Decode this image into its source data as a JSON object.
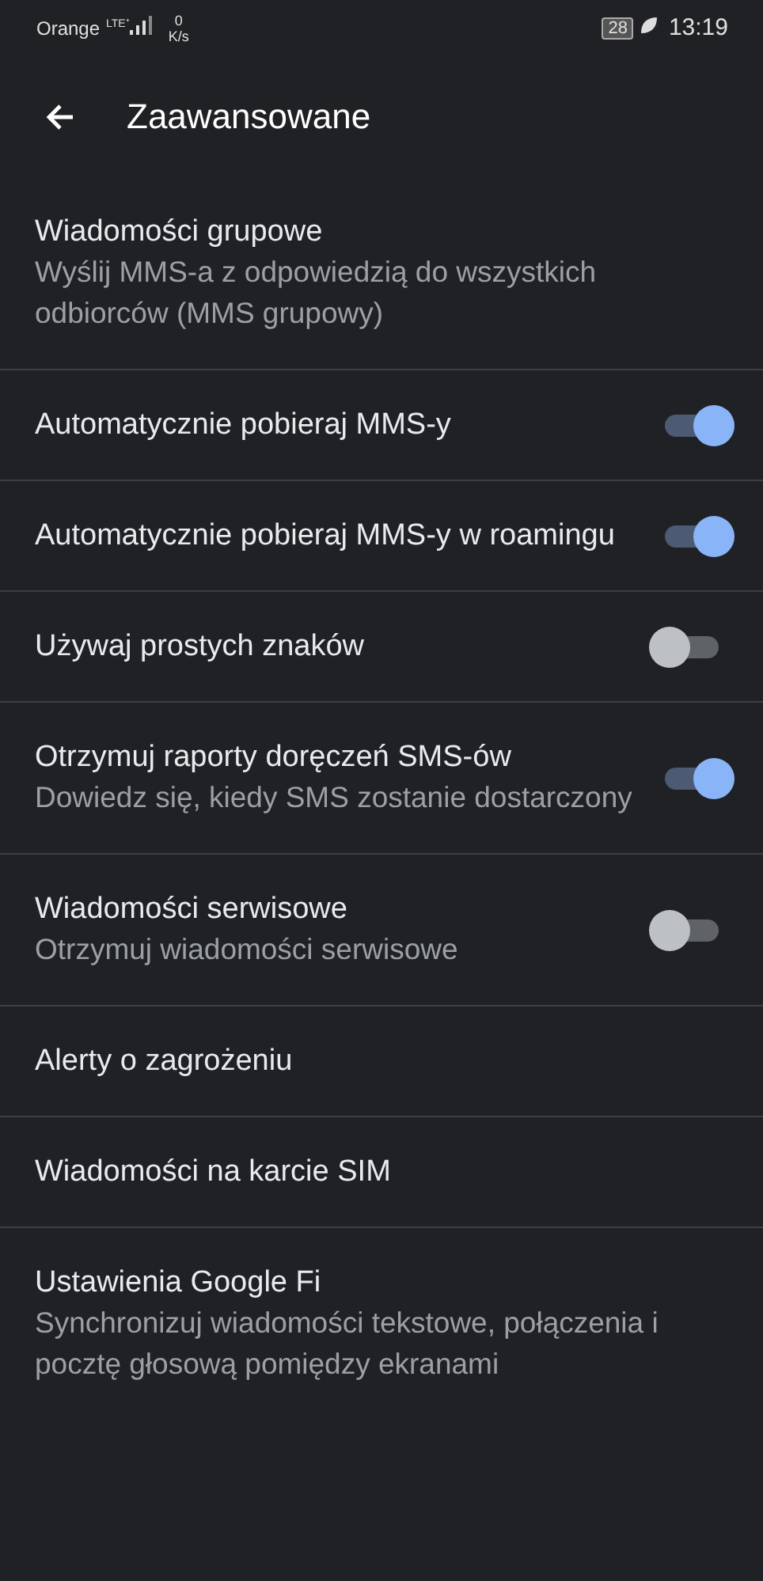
{
  "status_bar": {
    "carrier": "Orange",
    "network": "LTE⁺",
    "speed_value": "0",
    "speed_unit": "K/s",
    "battery": "28",
    "time": "13:19"
  },
  "toolbar": {
    "title": "Zaawansowane"
  },
  "settings": [
    {
      "kind": "plain",
      "title": "Wiadomości grupowe",
      "summary": "Wyślij MMS-a z odpowiedzią do wszystkich odbiorców (MMS grupowy)"
    },
    {
      "kind": "toggle",
      "title": "Automatycznie pobieraj MMS-y",
      "on": true
    },
    {
      "kind": "toggle",
      "title": "Automatycznie pobieraj MMS-y w roamingu",
      "on": true
    },
    {
      "kind": "toggle",
      "title": "Używaj prostych znaków",
      "on": false
    },
    {
      "kind": "toggle",
      "title": "Otrzymuj raporty doręczeń SMS-ów",
      "summary": "Dowiedz się, kiedy SMS zostanie dostarczony",
      "on": true
    },
    {
      "kind": "toggle",
      "title": "Wiadomości serwisowe",
      "summary": "Otrzymuj wiadomości serwisowe",
      "on": false
    },
    {
      "kind": "plain",
      "title": "Alerty o zagrożeniu"
    },
    {
      "kind": "plain",
      "title": "Wiadomości na karcie SIM"
    },
    {
      "kind": "plain",
      "title": "Ustawienia Google Fi",
      "summary": "Synchronizuj wiadomości tekstowe, połączenia i pocztę głosową pomiędzy ekranami"
    }
  ]
}
